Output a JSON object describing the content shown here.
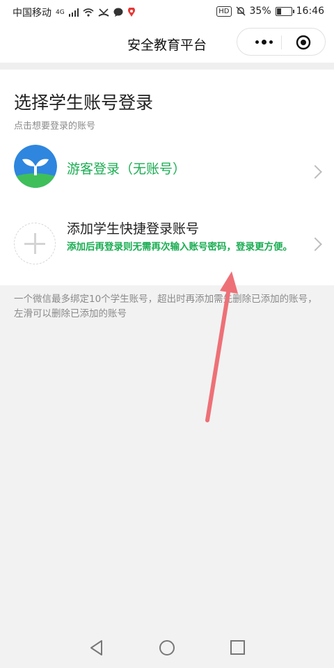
{
  "status_bar": {
    "carrier": "中国移动",
    "network": "4G",
    "battery_percent": "35%",
    "battery_level": 0.35,
    "time": "16:46",
    "hd_badge": "HD",
    "icons": [
      "signal-icon",
      "wifi-icon",
      "missed-call-icon",
      "message-icon",
      "location-icon",
      "mute-icon",
      "battery-icon"
    ]
  },
  "nav": {
    "title": "安全教育平台",
    "icons": [
      "more-icon",
      "close-miniprogram-icon"
    ]
  },
  "card": {
    "title": "选择学生账号登录",
    "subtitle": "点击想要登录的账号",
    "guest": {
      "label": "游客登录（无账号）",
      "icon": "sprout-logo-icon"
    },
    "add": {
      "title": "添加学生快捷登录账号",
      "desc": "添加后再登录则无需再次输入账号密码，登录更方便。",
      "icon": "plus-icon"
    }
  },
  "hint": "一个微信最多绑定10个学生账号，超出时再添加需先删除已添加的账号，左滑可以删除已添加的账号",
  "colors": {
    "accent_green": "#1aad52",
    "annotation_arrow": "#ee7077",
    "logo_blue": "#2e86de"
  },
  "bottom_nav": {
    "icons": [
      "back-icon",
      "home-icon",
      "recents-icon"
    ]
  }
}
